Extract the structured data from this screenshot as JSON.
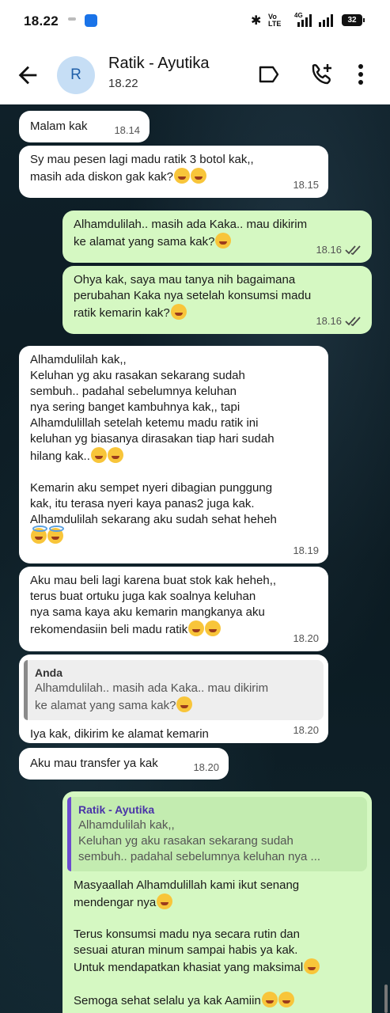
{
  "status_bar": {
    "time": "18.22",
    "volte": "Vo\nLTE",
    "net": "4G",
    "battery": "32"
  },
  "header": {
    "avatar_letter": "R",
    "name": "Ratik - Ayutika",
    "last_seen": "18.22"
  },
  "colors": {
    "incoming": "#ffffff",
    "outgoing": "#d5f8c2",
    "accent": "#6b4bcf",
    "read_ticks": "#4a4a4a"
  },
  "messages": [
    {
      "dir": "in",
      "text": "Malam kak",
      "time": "18.14"
    },
    {
      "dir": "in",
      "text": "Sy mau pesen lagi madu ratik 3 botol kak,,\nmasih ada diskon gak kak?",
      "emoji": "sweat-smile-icon x2",
      "time": "18.15"
    },
    {
      "dir": "out",
      "text": "Alhamdulilah.. masih ada Kaka.. mau dikirim\nke alamat yang sama kak?",
      "emoji": "smiling-icon",
      "time": "18.16",
      "status": "read"
    },
    {
      "dir": "out",
      "text": "Ohya kak, saya mau tanya nih bagaimana\nperubahan Kaka nya setelah konsumsi madu\nratik kemarin kak?",
      "emoji": "hugging-icon",
      "time": "18.16",
      "status": "read"
    },
    {
      "dir": "in",
      "text": "Alhamdulilah kak,,\nKeluhan yg aku rasakan sekarang sudah\nsembuh.. padahal sebelumnya keluhan\nnya sering banget kambuhnya kak,, tapi\nAlhamdulillah setelah ketemu madu ratik ini\nkeluhan yg biasanya dirasakan tiap hari sudah\nhilang kak..",
      "text2": "Kemarin aku sempet nyeri dibagian punggung\nkak, itu terasa nyeri kaya panas2 juga kak.\nAlhamdulilah sekarang aku sudah sehat heheh",
      "emoji": "grin-icon x2",
      "emoji2": "halo-icon x2",
      "time": "18.19"
    },
    {
      "dir": "in",
      "text": "Aku mau beli lagi karena buat stok kak heheh,,\nterus buat ortuku juga kak soalnya keluhan\nnya sama kaya aku kemarin mangkanya aku\nrekomendasiin beli madu ratik",
      "emoji": "grin-icon x2",
      "time": "18.20"
    },
    {
      "dir": "in",
      "quote_author": "Anda",
      "quote_text": "Alhamdulilah.. masih ada Kaka.. mau dikirim\nke alamat yang sama kak?",
      "text": "Iya kak, dikirim ke alamat kemarin",
      "time": "18.20"
    },
    {
      "dir": "in",
      "text": "Aku mau transfer ya kak",
      "time": "18.20"
    },
    {
      "dir": "out",
      "quote_author": "Ratik - Ayutika",
      "quote_text": "Alhamdulilah kak,,\nKeluhan yg aku rasakan sekarang sudah\nsembuh.. padahal sebelumnya keluhan nya ...",
      "text": "Masyaallah Alhamdulillah kami ikut senang\nmendengar nya",
      "text2": "Terus konsumsi madu nya secara rutin dan\nsesuai aturan minum sampai habis ya kak.\nUntuk mendapatkan khasiat yang maksimal",
      "text3": "Semoga sehat selalu ya kak Aamiin"
    }
  ]
}
